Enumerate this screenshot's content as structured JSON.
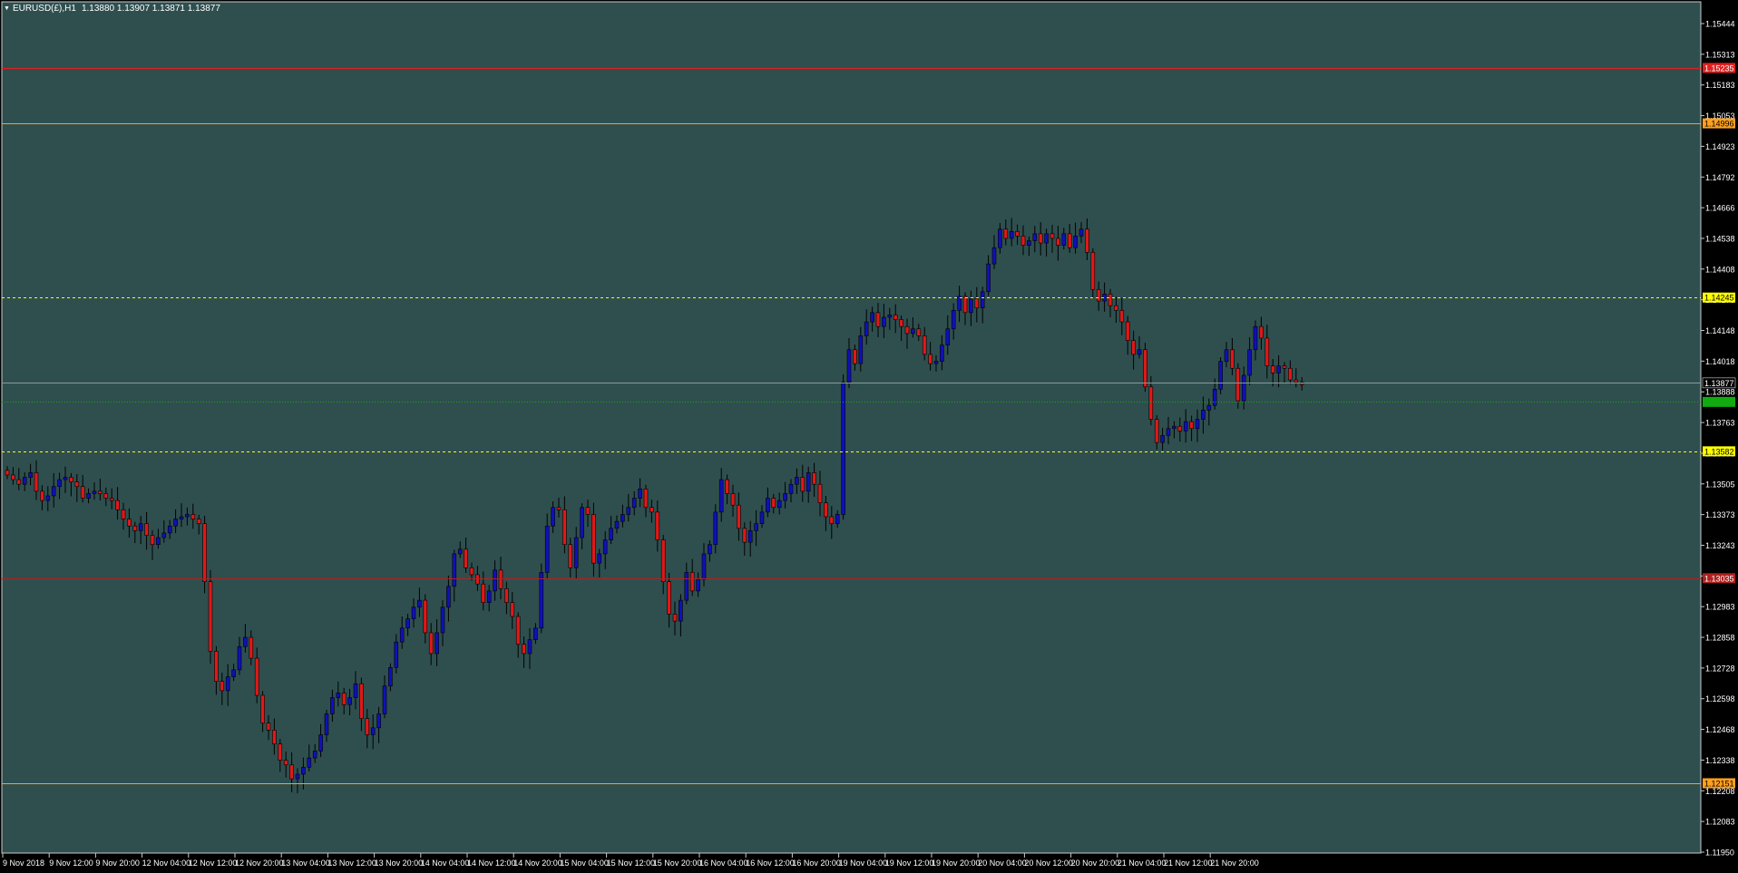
{
  "colors": {
    "plot_bg": "#2f4f4f",
    "outer_bg": "#000000",
    "bull_candle": "#1010b8",
    "bear_candle": "#e01818",
    "wick": "#000000",
    "axis_text": "#ffffff",
    "bid_line": "#8a9a9a",
    "green_line": "#11aa11"
  },
  "chart_title": {
    "symbol_timeframe": "EURUSD(£),H1",
    "ohlc": "1.13880 1.13907 1.13871 1.13877"
  },
  "chart_data": {
    "type": "candlestick",
    "title": "EURUSD(£),H1",
    "ylim": [
      1.1185,
      1.1552
    ],
    "grid": false,
    "y_ticks": [
      "1.15444",
      "1.15313",
      "1.15183",
      "1.15053",
      "1.14923",
      "1.14792",
      "1.14666",
      "1.14538",
      "1.14408",
      "1.14275",
      "1.14148",
      "1.14018",
      "1.13888",
      "1.13763",
      "1.13633",
      "1.13505",
      "1.13373",
      "1.13243",
      "1.13113",
      "1.12983",
      "1.12858",
      "1.12728",
      "1.12598",
      "1.12468",
      "1.12338",
      "1.12208",
      "1.12083",
      "1.11950"
    ],
    "x_ticks": [
      "9 Nov 2018",
      "9 Nov 12:00",
      "9 Nov 20:00",
      "12 Nov 04:00",
      "12 Nov 12:00",
      "12 Nov 20:00",
      "13 Nov 04:00",
      "13 Nov 12:00",
      "13 Nov 20:00",
      "14 Nov 04:00",
      "14 Nov 12:00",
      "14 Nov 20:00",
      "15 Nov 04:00",
      "15 Nov 12:00",
      "15 Nov 20:00",
      "16 Nov 04:00",
      "16 Nov 12:00",
      "16 Nov 20:00",
      "19 Nov 04:00",
      "19 Nov 12:00",
      "19 Nov 20:00",
      "20 Nov 04:00",
      "20 Nov 12:00",
      "20 Nov 20:00",
      "21 Nov 04:00",
      "21 Nov 12:00",
      "21 Nov 20:00"
    ],
    "x_tick_bar_index": [
      0,
      8,
      16,
      24,
      32,
      40,
      48,
      56,
      64,
      72,
      80,
      88,
      96,
      104,
      112,
      120,
      128,
      136,
      144,
      152,
      160,
      168,
      176,
      184,
      192,
      200,
      208
    ],
    "levels": [
      {
        "price": 1.15235,
        "color": "#e02020",
        "style": "solid",
        "label": "1.15235"
      },
      {
        "price": 1.14996,
        "color": "#ffa020",
        "style": "solid",
        "label": "1.14996"
      },
      {
        "price": 1.14245,
        "color": "#ffff00",
        "style": "dashed",
        "label": "1.14245"
      },
      {
        "price": 1.13877,
        "color": "#8a9a9a",
        "style": "solid",
        "label": "1.13877"
      },
      {
        "price": 1.13582,
        "color": "#ffff00",
        "style": "dashed",
        "label": "1.13582"
      },
      {
        "price": 1.13035,
        "color": "#b02020",
        "style": "solid",
        "label": "1.13035"
      },
      {
        "price": 1.12151,
        "color": "#ffa020",
        "style": "solid",
        "label": "1.12151"
      }
    ],
    "markers": [
      {
        "price": 1.13795,
        "color": "#11aa11",
        "label": ""
      }
    ],
    "close_series": [
      1.1348,
      1.1346,
      1.1344,
      1.1347,
      1.1349,
      1.1341,
      1.1337,
      1.1339,
      1.1343,
      1.1346,
      1.1347,
      1.1345,
      1.1343,
      1.1338,
      1.134,
      1.1341,
      1.134,
      1.1338,
      1.1337,
      1.1333,
      1.1329,
      1.1326,
      1.1324,
      1.1327,
      1.1322,
      1.1318,
      1.1321,
      1.1323,
      1.1326,
      1.1329,
      1.133,
      1.1331,
      1.1329,
      1.1327,
      1.1302,
      1.1272,
      1.1259,
      1.1255,
      1.1261,
      1.1264,
      1.1274,
      1.1278,
      1.1269,
      1.1253,
      1.1241,
      1.1238,
      1.1232,
      1.1225,
      1.1223,
      1.1217,
      1.1219,
      1.1222,
      1.1226,
      1.1229,
      1.1236,
      1.1245,
      1.1252,
      1.1254,
      1.1249,
      1.1252,
      1.1258,
      1.1243,
      1.1236,
      1.1239,
      1.1245,
      1.1257,
      1.1265,
      1.1276,
      1.1282,
      1.1286,
      1.1291,
      1.1294,
      1.128,
      1.1271,
      1.128,
      1.1291,
      1.13,
      1.1314,
      1.1316,
      1.1308,
      1.1305,
      1.1301,
      1.1293,
      1.1298,
      1.1307,
      1.1299,
      1.1293,
      1.1287,
      1.1275,
      1.1271,
      1.1277,
      1.1282,
      1.1306,
      1.1326,
      1.1334,
      1.1333,
      1.1318,
      1.1308,
      1.1321,
      1.1334,
      1.1331,
      1.131,
      1.1314,
      1.132,
      1.1325,
      1.1328,
      1.1331,
      1.1334,
      1.1338,
      1.1342,
      1.1334,
      1.1332,
      1.132,
      1.1302,
      1.1288,
      1.1285,
      1.1294,
      1.1306,
      1.1298,
      1.1303,
      1.1314,
      1.1318,
      1.1332,
      1.1346,
      1.134,
      1.1335,
      1.1325,
      1.1319,
      1.1324,
      1.1327,
      1.1332,
      1.1338,
      1.1334,
      1.1337,
      1.134,
      1.1344,
      1.1347,
      1.1341,
      1.1349,
      1.1344,
      1.1336,
      1.133,
      1.1327,
      1.1331,
      1.1388,
      1.1402,
      1.1396,
      1.1408,
      1.1414,
      1.1418,
      1.1412,
      1.1416,
      1.1417,
      1.1415,
      1.1412,
      1.1409,
      1.1411,
      1.1408,
      1.14,
      1.1396,
      1.1397,
      1.1404,
      1.1411,
      1.1419,
      1.1425,
      1.1418,
      1.1424,
      1.142,
      1.1427,
      1.1439,
      1.1446,
      1.1454,
      1.145,
      1.1453,
      1.1451,
      1.1447,
      1.1449,
      1.1452,
      1.1448,
      1.1452,
      1.145,
      1.1447,
      1.1452,
      1.1446,
      1.1451,
      1.1454,
      1.1444,
      1.1428,
      1.1423,
      1.1426,
      1.1421,
      1.1419,
      1.1414,
      1.1406,
      1.14,
      1.1402,
      1.1386,
      1.1372,
      1.1362,
      1.1365,
      1.1368,
      1.1369,
      1.1367,
      1.1371,
      1.1368,
      1.1372,
      1.1376,
      1.1378,
      1.1385,
      1.1397,
      1.1402,
      1.1394,
      1.138,
      1.1391,
      1.1402,
      1.1412,
      1.1407,
      1.1395,
      1.1392,
      1.1395,
      1.1394,
      1.1389,
      1.1388,
      1.1387
    ],
    "last_price": "1.13877"
  }
}
